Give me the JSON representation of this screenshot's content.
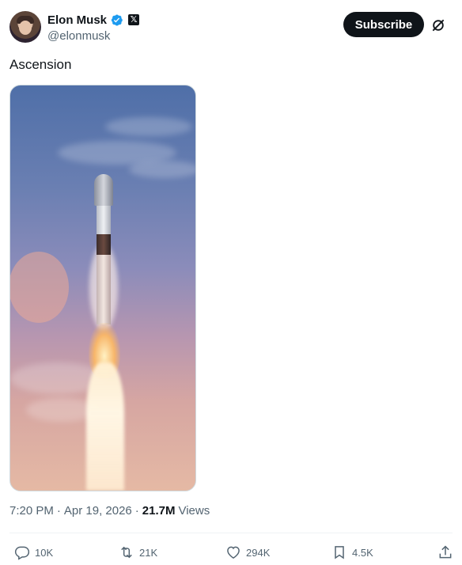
{
  "author": {
    "display_name": "Elon Musk",
    "handle": "@elonmusk",
    "verified_icon": "verified-badge-icon",
    "affiliation_icon": "x-logo-icon",
    "affiliation_glyph": "𝕏"
  },
  "header": {
    "subscribe_label": "Subscribe",
    "grok_icon": "grok-icon"
  },
  "tweet": {
    "text": "Ascension",
    "media_alt": "Rocket launching into the sky"
  },
  "meta": {
    "time": "7:20 PM",
    "separator": "·",
    "date": "Apr 19, 2026",
    "views_count": "21.7M",
    "views_label": "Views"
  },
  "actions": {
    "replies": "10K",
    "reposts": "21K",
    "likes": "294K",
    "bookmarks": "4.5K"
  },
  "colors": {
    "text_primary": "#0f1419",
    "text_secondary": "#536471",
    "verified_blue": "#1d9bf0",
    "button_dark": "#0f1419"
  }
}
